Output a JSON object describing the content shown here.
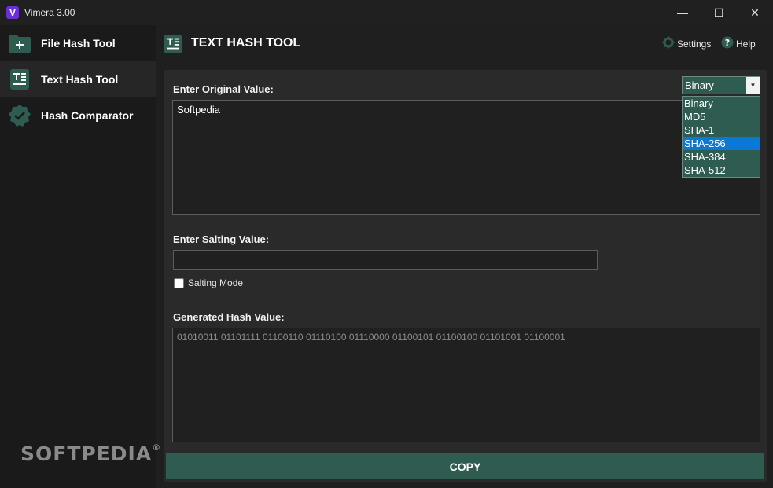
{
  "window": {
    "logo_letter": "V",
    "title": "Vimera 3.00",
    "minimize": "—",
    "maximize": "☐",
    "close": "✕"
  },
  "sidebar": {
    "items": [
      {
        "label": "File Hash Tool",
        "icon": "folder-plus-icon"
      },
      {
        "label": "Text Hash Tool",
        "icon": "text-document-icon",
        "active": true
      },
      {
        "label": "Hash Comparator",
        "icon": "verified-badge-icon"
      }
    ]
  },
  "watermark": {
    "text": "SOFTPEDIA",
    "mark": "®"
  },
  "header": {
    "title": "TEXT HASH TOOL",
    "settings_label": "Settings",
    "help_label": "Help"
  },
  "form": {
    "original_label": "Enter Original Value:",
    "original_value": "Softpedia",
    "salt_label": "Enter Salting Value:",
    "salt_value": "",
    "salting_mode_label": "Salting Mode",
    "salting_mode_checked": false,
    "hash_label": "Generated Hash Value:",
    "hash_value": "01010011 01101111 01100110 01110100 01110000 01100101 01100100 01101001 01100001",
    "copy_label": "COPY"
  },
  "algorithm": {
    "selected": "Binary",
    "options": [
      "Binary",
      "MD5",
      "SHA-1",
      "SHA-256",
      "SHA-384",
      "SHA-512"
    ],
    "highlighted": "SHA-256"
  },
  "colors": {
    "accent": "#2e5c50",
    "highlight": "#0a78d7",
    "background": "#1f1f1f",
    "panel": "#2a2a2a"
  }
}
